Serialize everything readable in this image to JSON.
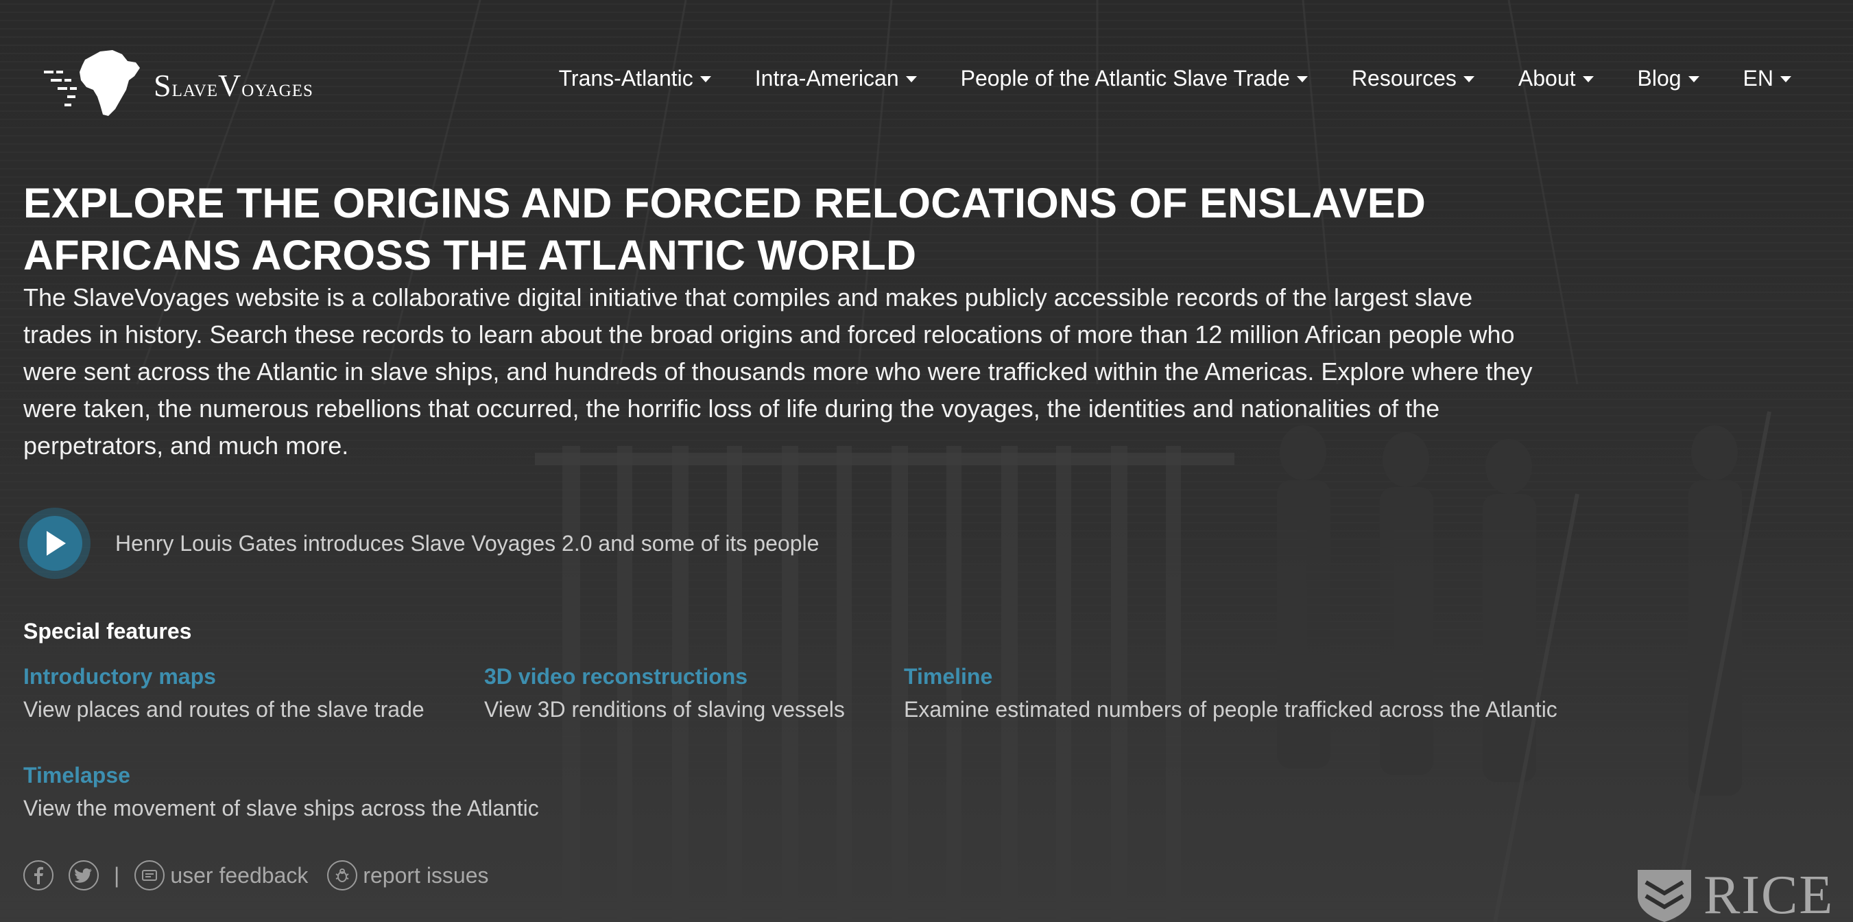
{
  "brand": {
    "name_first_cap": "S",
    "name_first_rest": "lave",
    "name_second_cap": "V",
    "name_second_rest": "oyages"
  },
  "nav": {
    "items": [
      {
        "label": "Trans-Atlantic"
      },
      {
        "label": "Intra-American"
      },
      {
        "label": "People of the Atlantic Slave Trade"
      },
      {
        "label": "Resources"
      },
      {
        "label": "About"
      },
      {
        "label": "Blog"
      },
      {
        "label": "EN"
      }
    ]
  },
  "hero": {
    "title": "Explore the origins and forced relocations of enslaved Africans across the Atlantic world",
    "description": "The SlaveVoyages website is a collaborative digital initiative that compiles and makes publicly accessible records of the largest slave trades in history. Search these records to learn about the broad origins and forced relocations of more than 12 million African people who were sent across the Atlantic in slave ships, and hundreds of thousands more who were trafficked within the Americas. Explore where they were taken, the numerous rebellions that occurred, the horrific loss of life during the voyages, the identities and nationalities of the perpetrators, and much more."
  },
  "video": {
    "caption": "Henry Louis Gates introduces Slave Voyages 2.0 and some of its people",
    "icon": "play-icon"
  },
  "special_features": {
    "heading": "Special features",
    "items": [
      {
        "title": "Introductory maps",
        "description": "View places and routes of the slave trade"
      },
      {
        "title": "3D video reconstructions",
        "description": "View 3D renditions of slaving vessels"
      },
      {
        "title": "Timeline",
        "description": "Examine estimated numbers of people trafficked across the Atlantic"
      },
      {
        "title": "Timelapse",
        "description": "View the movement of slave ships across the Atlantic"
      }
    ]
  },
  "footer": {
    "separator": "|",
    "feedback_label": "user feedback",
    "issues_label": "report issues",
    "icons": [
      "facebook-icon",
      "twitter-icon",
      "feedback-icon",
      "bug-icon"
    ]
  },
  "rice": {
    "label": "RICE"
  },
  "colors": {
    "accent": "#3d8fb0",
    "play_button": "#2b7493",
    "muted_text": "#cfcfcf"
  }
}
